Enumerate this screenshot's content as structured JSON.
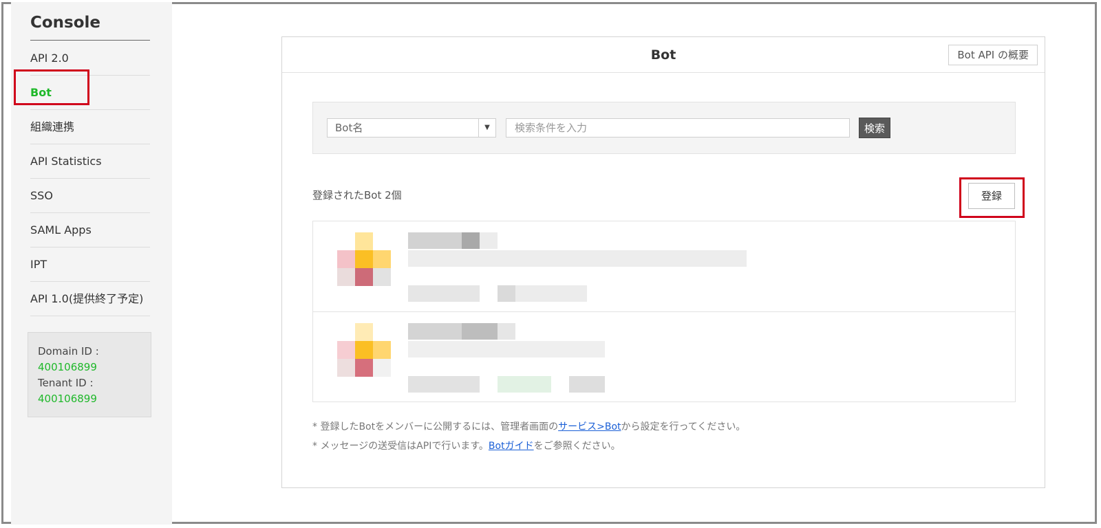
{
  "sidebar": {
    "title": "Console",
    "items": [
      {
        "label": "API 2.0"
      },
      {
        "label": "Bot"
      },
      {
        "label": "組織連携"
      },
      {
        "label": "API Statistics"
      },
      {
        "label": "SSO"
      },
      {
        "label": "SAML Apps"
      },
      {
        "label": "IPT"
      },
      {
        "label": "API 1.0(提供終了予定)"
      }
    ],
    "domain": {
      "domain_label": "Domain ID :",
      "domain_value": "400106899",
      "tenant_label": "Tenant ID :",
      "tenant_value": "400106899"
    }
  },
  "main": {
    "title": "Bot",
    "overview_button": "Bot API の概要",
    "search": {
      "select_value": "Bot名",
      "placeholder": "検索条件を入力",
      "button": "検索"
    },
    "count_label": "登録されたBot 2個",
    "register_button": "登録",
    "notes": {
      "line1_prefix": "* 登録したBotをメンバーに公開するには、管理者画面の",
      "line1_link": "サービス>Bot",
      "line1_suffix": "から設定を行ってください。",
      "line2_prefix": "* メッセージの送受信はAPIで行います。",
      "line2_link": "Botガイド",
      "line2_suffix": "をご参照ください。"
    }
  },
  "colors": {
    "accent_green": "#1fb82a",
    "highlight_red": "#d0021b",
    "link_blue": "#1a5fd6"
  }
}
